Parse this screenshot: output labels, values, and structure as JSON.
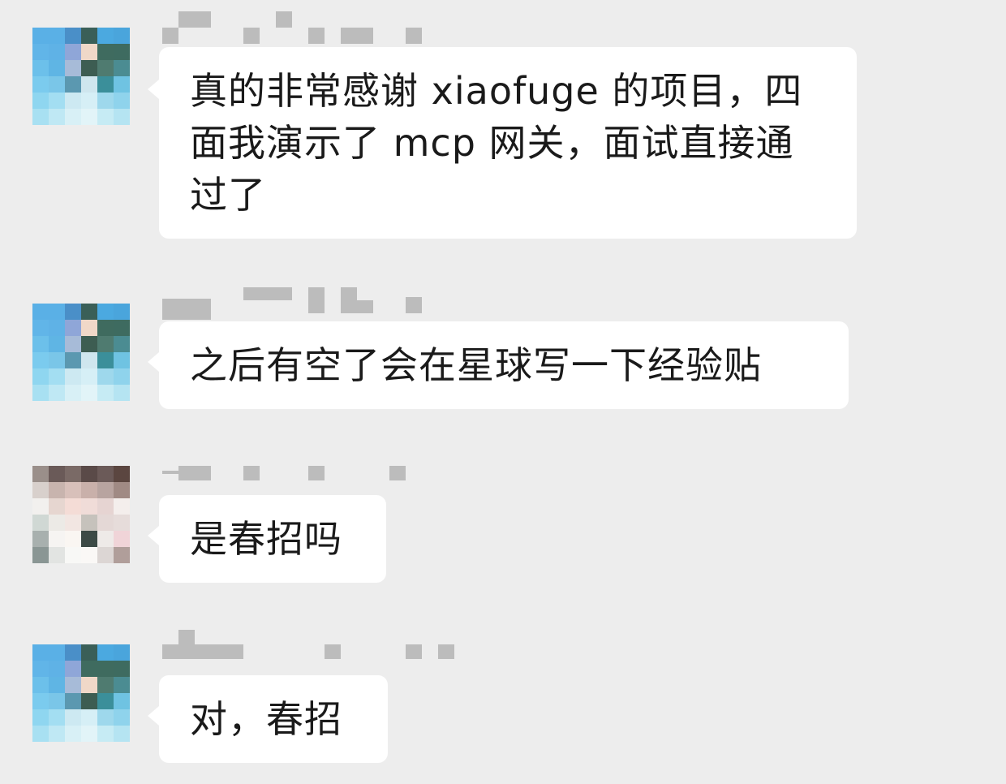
{
  "chat": {
    "messages": [
      {
        "sender_redacted": true,
        "text": "真的非常感谢 xiaofuge 的项目，四面我演示了 mcp 网关，面试直接通过了"
      },
      {
        "sender_redacted": true,
        "text": "之后有空了会在星球写一下经验贴"
      },
      {
        "sender_redacted": true,
        "text": "是春招吗"
      },
      {
        "sender_redacted": true,
        "text": "对，春招"
      }
    ]
  },
  "colors": {
    "background": "#ededed",
    "bubble": "#ffffff",
    "text": "#1a1a1a",
    "blur": "#bcbcbc"
  }
}
